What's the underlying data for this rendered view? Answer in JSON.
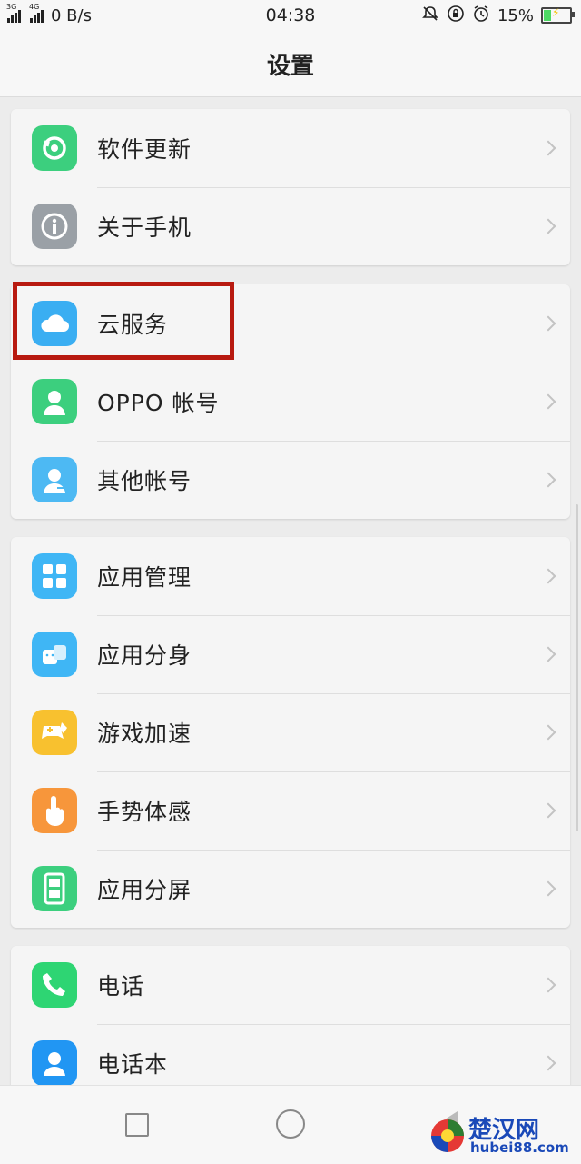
{
  "status": {
    "net1": "3G",
    "net2": "4G",
    "speed": "0 B/s",
    "time": "04:38",
    "battery": "15%"
  },
  "header": {
    "title": "设置"
  },
  "groups": [
    {
      "items": [
        {
          "label": "软件更新",
          "icon": "software-update-icon",
          "color": "#3ccf7e"
        },
        {
          "label": "关于手机",
          "icon": "info-icon",
          "color": "#9aa0a6"
        }
      ]
    },
    {
      "items": [
        {
          "label": "云服务",
          "icon": "cloud-icon",
          "color": "#3aaef2"
        },
        {
          "label": "OPPO 帐号",
          "icon": "account-icon",
          "color": "#3ccf7e"
        },
        {
          "label": "其他帐号",
          "icon": "other-account-icon",
          "color": "#4db9f3"
        }
      ]
    },
    {
      "items": [
        {
          "label": "应用管理",
          "icon": "app-manage-icon",
          "color": "#3fb6f5"
        },
        {
          "label": "应用分身",
          "icon": "app-clone-icon",
          "color": "#3fb6f5"
        },
        {
          "label": "游戏加速",
          "icon": "game-boost-icon",
          "color": "#f8c12f"
        },
        {
          "label": "手势体感",
          "icon": "gesture-icon",
          "color": "#f7963b"
        },
        {
          "label": "应用分屏",
          "icon": "split-screen-icon",
          "color": "#3ccf7e"
        }
      ]
    },
    {
      "items": [
        {
          "label": "电话",
          "icon": "phone-icon",
          "color": "#2ed573"
        },
        {
          "label": "电话本",
          "icon": "contacts-icon",
          "color": "#2196f3"
        }
      ]
    }
  ],
  "watermark": {
    "line1": "楚汉网",
    "line2": "hubei88.com"
  }
}
